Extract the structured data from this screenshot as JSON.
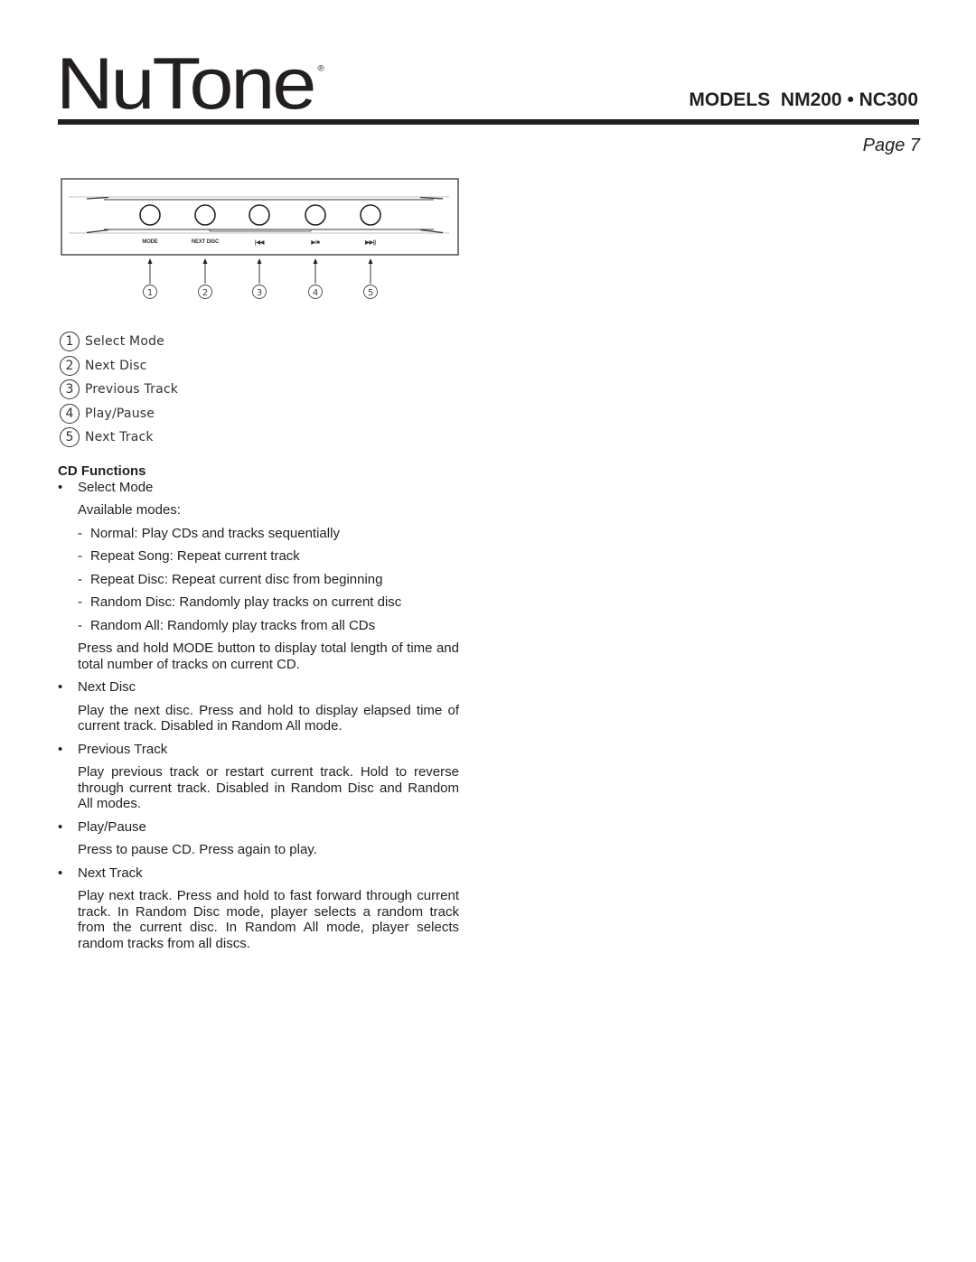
{
  "header": {
    "brand": "NuTone",
    "brand_mark": "®",
    "models_label": "MODELS  NM200 • NC300",
    "page_label": "Page 7"
  },
  "diagram": {
    "buttons": [
      {
        "number": "1",
        "label": "MODE",
        "icon": "mode-text"
      },
      {
        "number": "2",
        "label": "NEXT DISC",
        "icon": "next-disc-text"
      },
      {
        "number": "3",
        "label": "|◀◀",
        "icon": "previous-track-icon"
      },
      {
        "number": "4",
        "label": "▶/■",
        "icon": "play-stop-icon"
      },
      {
        "number": "5",
        "label": "▶▶||",
        "icon": "next-track-icon"
      }
    ]
  },
  "legend": [
    {
      "number": "1",
      "text": "Select Mode"
    },
    {
      "number": "2",
      "text": "Next Disc"
    },
    {
      "number": "3",
      "text": "Previous Track"
    },
    {
      "number": "4",
      "text": "Play/Pause"
    },
    {
      "number": "5",
      "text": "Next Track"
    }
  ],
  "cd_functions": {
    "title": "CD Functions",
    "bullet_glyph": "•",
    "dash_glyph": "-",
    "select_mode": {
      "heading": "Select Mode",
      "intro": "Available modes:",
      "modes": [
        "Normal:  Play CDs and tracks sequentially",
        "Repeat Song:  Repeat current track",
        "Repeat Disc:  Repeat current disc from beginning",
        "Random Disc:  Randomly play tracks on current disc",
        "Random All:  Randomly play tracks from all CDs"
      ],
      "note": "Press and hold MODE button to display total length of time and total number of tracks on current CD."
    },
    "next_disc": {
      "heading": "Next Disc",
      "text": "Play the next disc. Press and hold to display elapsed time of current track. Disabled in Random All mode."
    },
    "previous_track": {
      "heading": "Previous Track",
      "text": "Play previous track or restart current track. Hold to reverse through current track. Disabled in Random Disc and Random All modes."
    },
    "play_pause": {
      "heading": "Play/Pause",
      "text": "Press to pause CD. Press again to play."
    },
    "next_track": {
      "heading": "Next Track",
      "text": "Play next track.  Press and hold to fast forward through current track.  In Random Disc mode, player selects a random track from the current disc.  In Random All mode, player selects random tracks from all discs."
    }
  }
}
